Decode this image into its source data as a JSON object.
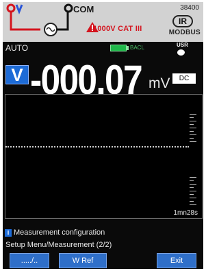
{
  "header": {
    "com_label": "COM",
    "category_label": "1000V CAT III",
    "model": "38400",
    "ir_label": "IR",
    "protocol": "MODBUS"
  },
  "status": {
    "range_mode": "AUTO",
    "battery_label": "BACL",
    "user_label": "USR"
  },
  "reading": {
    "function_badge": "V",
    "value": "-000.07",
    "unit": "mV",
    "coupling": "DC"
  },
  "graph": {
    "elapsed_time": "1mn28s"
  },
  "footer": {
    "info_text": "Measurement configuration",
    "menu_path": "Setup Menu/Measurement (2/2)"
  },
  "softkeys": {
    "key1": "...../..",
    "key2": "W Ref",
    "key3": "Exit"
  },
  "colors": {
    "accent_blue": "#1d6bd6",
    "warning_red": "#d4141e",
    "battery_green": "#1fb84a"
  }
}
